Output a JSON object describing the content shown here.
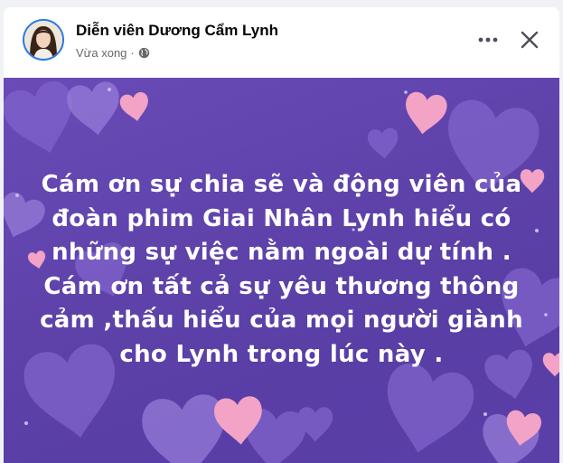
{
  "header": {
    "author_name": "Diễn viên Dương Cẩm Lynh",
    "timestamp": "Vừa xong",
    "separator": "·",
    "privacy_icon": "globe-icon",
    "more_icon": "more-horizontal-icon",
    "close_icon": "close-icon"
  },
  "post": {
    "background_color": "#5f43ab",
    "text_color": "#ffffff",
    "lines": [
      "Cám ơn sự chia sẽ và động viên của",
      "đoàn phim Giai Nhân Lynh hiểu có",
      "những sự việc nằm ngoài dự tính .",
      "Cám ơn tất cả sự yêu thương thông",
      "cảm ,thấu hiểu của mọi người giành",
      "cho Lynh trong lúc này ."
    ]
  },
  "colors": {
    "accent": "#2a7ae2",
    "heart_pink": "#f2a3c6",
    "heart_lavender": "#8f73d1"
  }
}
